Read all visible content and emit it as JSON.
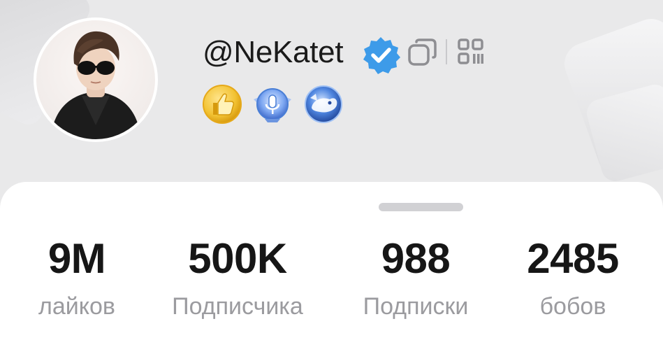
{
  "profile": {
    "username": "@NeKatet",
    "verified": true
  },
  "icons": {
    "verified": "verified-badge-icon",
    "copy": "copy-icon",
    "qr": "qr-code-icon",
    "badges": [
      "thumbs-up-badge-icon",
      "microphone-badge-icon",
      "creature-badge-icon"
    ]
  },
  "stats": [
    {
      "value": "9M",
      "label": "лайков"
    },
    {
      "value": "500K",
      "label": "Подписчика"
    },
    {
      "value": "988",
      "label": "Подписки"
    },
    {
      "value": "2485",
      "label": "бобов"
    }
  ],
  "colors": {
    "verified_blue": "#3d9be9",
    "badge_gold": "#f2c232",
    "badge_blue": "#4a7fd6",
    "label_gray": "#9b9b9f",
    "value_black": "#161616"
  }
}
